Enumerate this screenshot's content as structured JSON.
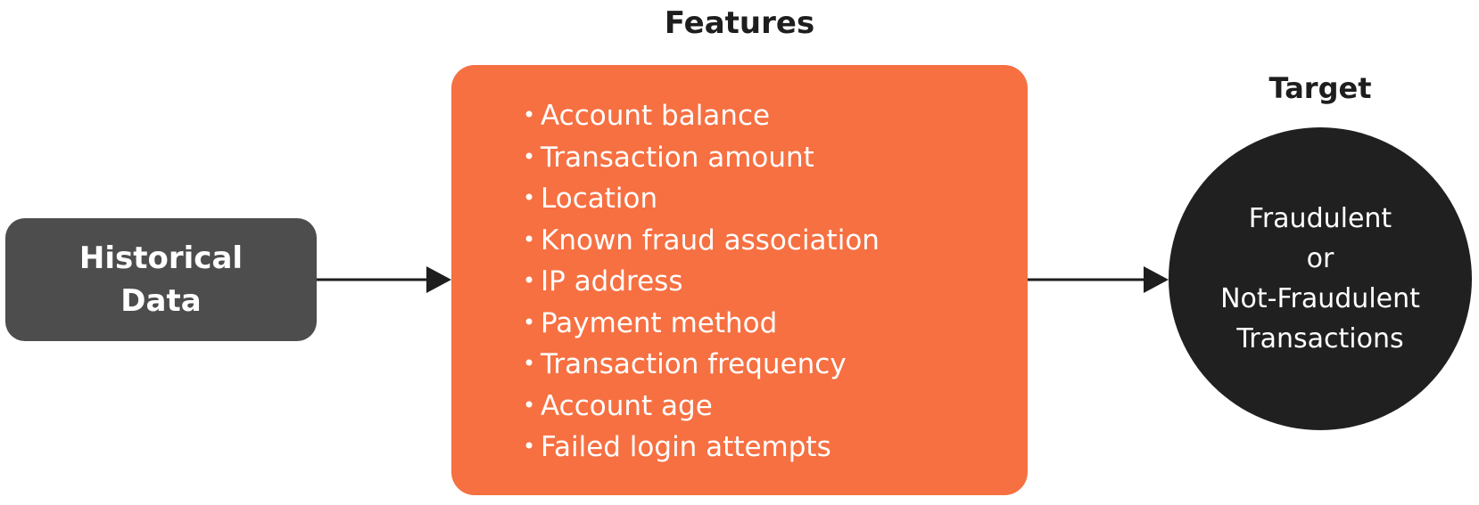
{
  "source": {
    "label_lines": [
      "Historical",
      "Data"
    ],
    "color": "#4d4d4d"
  },
  "features": {
    "title": "Features",
    "color": "#f67042",
    "bullet": "•",
    "items": [
      "Account balance",
      "Transaction amount",
      "Location",
      "Known fraud association",
      "IP address",
      "Payment method",
      "Transaction frequency",
      "Account age",
      "Failed login attempts"
    ]
  },
  "target": {
    "title": "Target",
    "color": "#202020",
    "label_lines": [
      "Fraudulent",
      "or",
      "Not-Fraudulent",
      "Transactions"
    ]
  },
  "edges": [
    {
      "from": "source",
      "to": "features"
    },
    {
      "from": "features",
      "to": "target"
    }
  ]
}
